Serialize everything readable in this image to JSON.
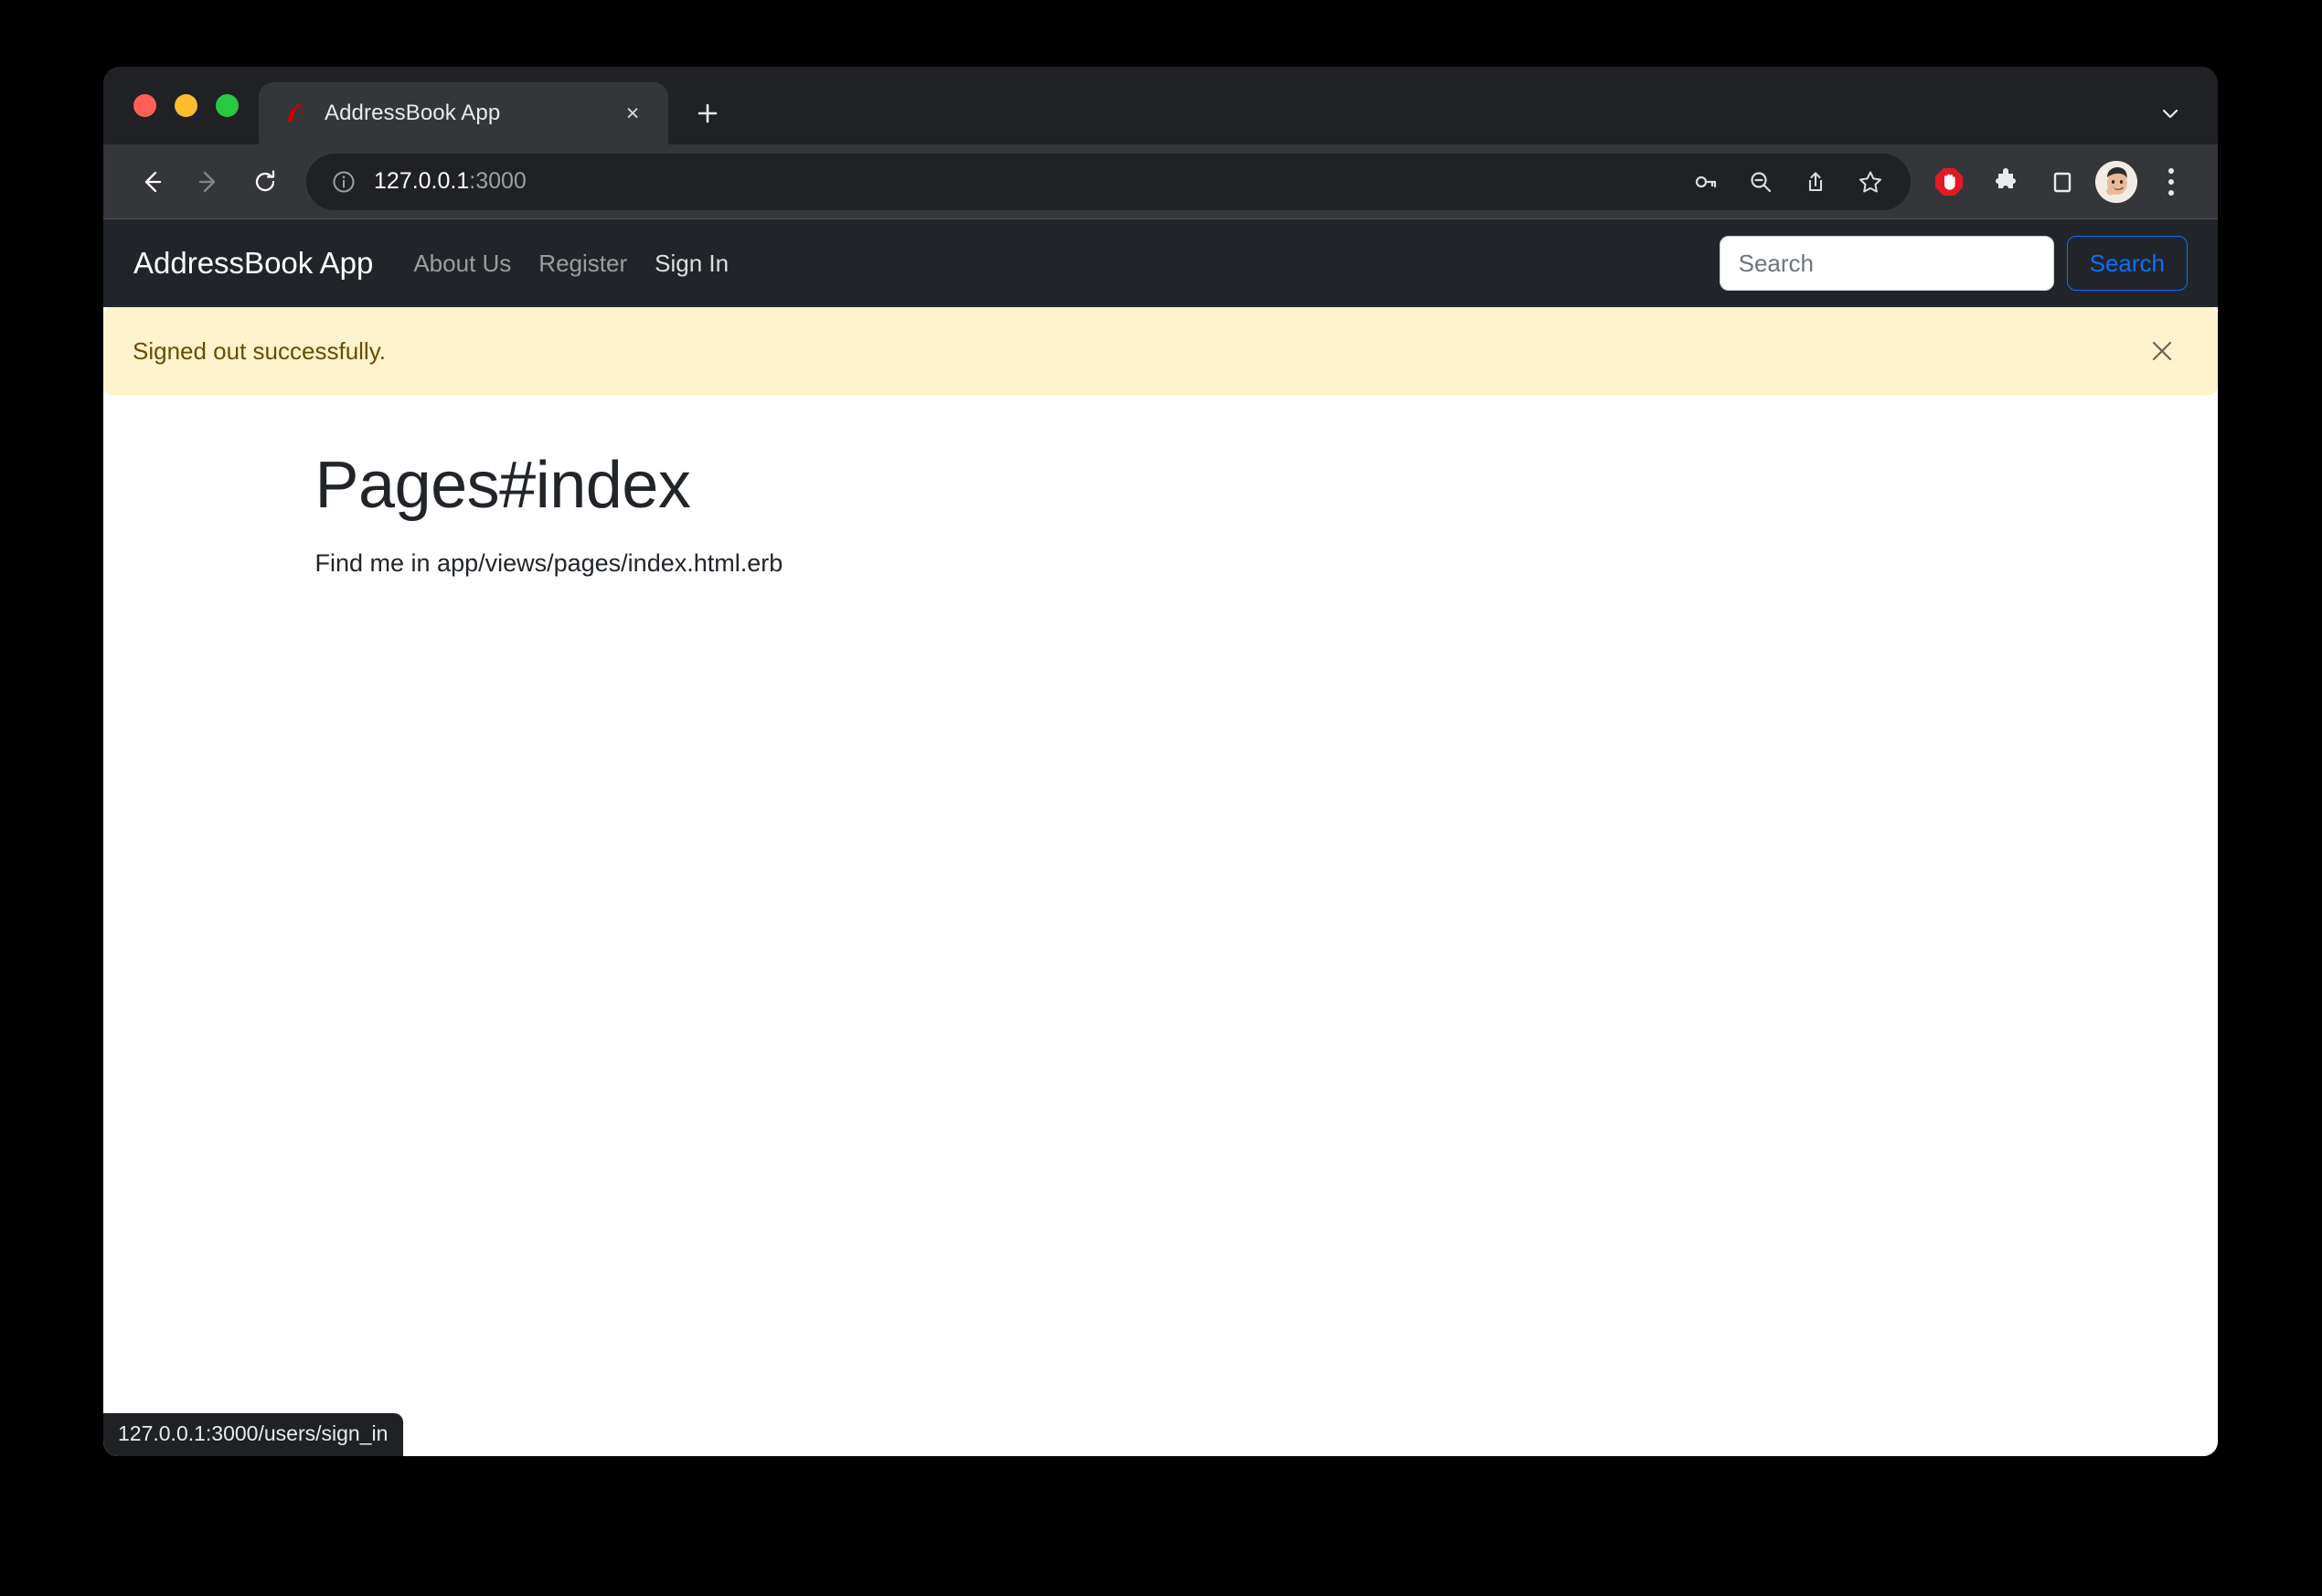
{
  "browser": {
    "window_controls": [
      "close",
      "minimize",
      "maximize"
    ],
    "tab": {
      "title": "AddressBook App",
      "favicon": "rails-logo-icon",
      "close_label": "×"
    },
    "new_tab_label": "+",
    "tabstrip_menu_label": "⌄",
    "toolbar": {
      "back_label": "←",
      "forward_label": "→",
      "reload_label": "↻",
      "url_host": "127.0.0.1",
      "url_port": ":3000",
      "site_info_icon": "info-circle-icon",
      "actions": [
        {
          "name": "password-key-icon",
          "label": "🗝"
        },
        {
          "name": "zoom-out-icon",
          "label": "⊖"
        },
        {
          "name": "share-icon",
          "label": "⇧"
        },
        {
          "name": "bookmark-star-icon",
          "label": "☆"
        }
      ],
      "extensions": [
        {
          "name": "adblock-icon",
          "label": "✋"
        },
        {
          "name": "extensions-puzzle-icon",
          "label": "🧩"
        },
        {
          "name": "side-panel-icon",
          "label": "□"
        }
      ],
      "avatar_name": "profile-avatar",
      "menu_label": "⋮"
    },
    "status_bubble": "127.0.0.1:3000/users/sign_in"
  },
  "page": {
    "navbar": {
      "brand": "AddressBook App",
      "links": [
        {
          "label": "About Us",
          "hovered": false
        },
        {
          "label": "Register",
          "hovered": false
        },
        {
          "label": "Sign In",
          "hovered": true
        }
      ],
      "search": {
        "placeholder": "Search",
        "value": "",
        "button_label": "Search"
      }
    },
    "flash": {
      "message": "Signed out successfully.",
      "close_label": "×",
      "type": "warning"
    },
    "content": {
      "heading": "Pages#index",
      "subtext": "Find me in app/views/pages/index.html.erb"
    }
  },
  "colors": {
    "browser_chrome": "#202124",
    "toolbar": "#35363a",
    "navbar_dark": "#212529",
    "alert_bg": "#fff3cd",
    "alert_text": "#664d03",
    "primary_blue": "#0d6efd",
    "rails_red": "#cc0000",
    "adblock_red": "#e01b24"
  }
}
